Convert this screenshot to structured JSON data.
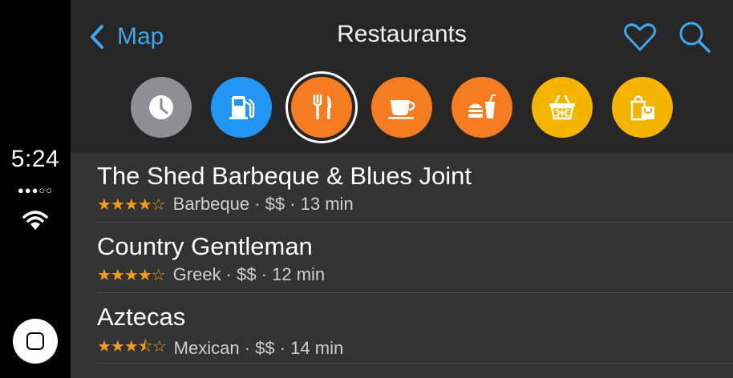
{
  "status": {
    "time": "5:24",
    "signal": "●●●○○",
    "wifi_icon": "wifi-icon"
  },
  "header": {
    "back_label": "Map",
    "title": "Restaurants",
    "accent_color": "#3ea7f0"
  },
  "categories": [
    {
      "name": "recent",
      "icon": "clock-icon",
      "color": "#8e8e93",
      "selected": false
    },
    {
      "name": "gas",
      "icon": "gas-pump-icon",
      "color": "#2196f3",
      "selected": false
    },
    {
      "name": "restaurants",
      "icon": "fork-knife-icon",
      "color": "#f57c20",
      "selected": true
    },
    {
      "name": "coffee",
      "icon": "coffee-cup-icon",
      "color": "#f57c20",
      "selected": false
    },
    {
      "name": "fast-food",
      "icon": "burger-drink-icon",
      "color": "#f57c20",
      "selected": false
    },
    {
      "name": "groceries",
      "icon": "basket-icon",
      "color": "#f5b400",
      "selected": false
    },
    {
      "name": "shopping",
      "icon": "shopping-bags-icon",
      "color": "#f5b400",
      "selected": false
    }
  ],
  "restaurants": [
    {
      "name": "The Shed Barbeque & Blues Joint",
      "rating": 4,
      "stars": "★★★★☆",
      "details": "Barbeque · $$ · 13 min"
    },
    {
      "name": "Country Gentleman",
      "rating": 4,
      "stars": "★★★★☆",
      "details": "Greek · $$ · 12 min"
    },
    {
      "name": "Aztecas",
      "rating": 3.5,
      "stars": "★★★⯪☆",
      "details": "Mexican · $$ · 14 min"
    }
  ]
}
